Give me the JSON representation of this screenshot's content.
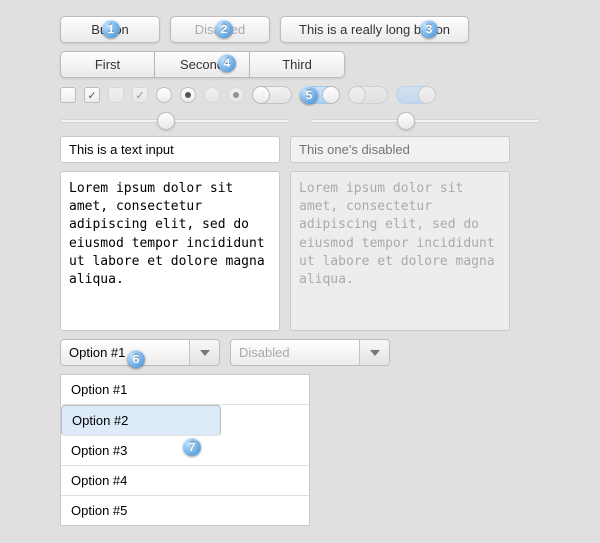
{
  "buttons": {
    "one": "Button",
    "two": "Disabled",
    "three": "This is a really long button"
  },
  "segmented": [
    "First",
    "Second",
    "Third"
  ],
  "text_input": {
    "value": "This is a text input"
  },
  "text_input_disabled": {
    "placeholder": "This one's disabled"
  },
  "textarea": {
    "value": "Lorem ipsum dolor sit amet, consectetur adipiscing elit, sed do eiusmod tempor incididunt ut labore et dolore magna aliqua."
  },
  "textarea_disabled": {
    "value": "Lorem ipsum dolor sit amet, consectetur adipiscing elit, sed do eiusmod tempor incididunt ut labore et dolore magna aliqua."
  },
  "select": {
    "value": "Option #1"
  },
  "select_disabled": {
    "value": "Disabled"
  },
  "listbox": {
    "options": [
      "Option #1",
      "Option #2",
      "Option #3",
      "Option #4",
      "Option #5"
    ],
    "selected_index": 1
  },
  "callouts": [
    "1",
    "2",
    "3",
    "4",
    "5",
    "6",
    "7"
  ]
}
